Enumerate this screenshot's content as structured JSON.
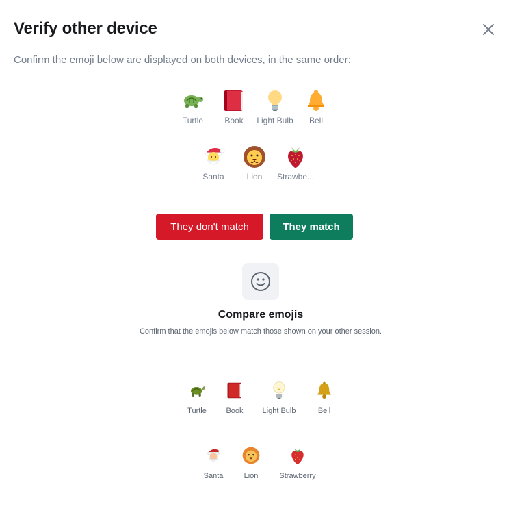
{
  "dialog": {
    "title": "Verify other device",
    "description": "Confirm the emoji below are displayed on both devices, in the same order:"
  },
  "emojis_top": [
    {
      "label": "Turtle",
      "icon": "turtle-icon"
    },
    {
      "label": "Book",
      "icon": "book-icon"
    },
    {
      "label": "Light Bulb",
      "icon": "light-bulb-icon"
    },
    {
      "label": "Bell",
      "icon": "bell-icon"
    },
    {
      "label": "Santa",
      "icon": "santa-icon"
    },
    {
      "label": "Lion",
      "icon": "lion-icon"
    },
    {
      "label": "Strawbe...",
      "icon": "strawberry-icon"
    }
  ],
  "buttons": {
    "dont_match": "They don't match",
    "match": "They match"
  },
  "compare": {
    "title": "Compare emojis",
    "subtitle": "Confirm that the emojis below match those shown on your other session.",
    "emojis": [
      {
        "label": "Turtle",
        "icon": "turtle-icon"
      },
      {
        "label": "Book",
        "icon": "book-icon"
      },
      {
        "label": "Light Bulb",
        "icon": "light-bulb-icon"
      },
      {
        "label": "Bell",
        "icon": "bell-icon"
      },
      {
        "label": "Santa",
        "icon": "santa-icon"
      },
      {
        "label": "Lion",
        "icon": "lion-icon"
      },
      {
        "label": "Strawberry",
        "icon": "strawberry-icon"
      }
    ]
  },
  "colors": {
    "danger": "#d51928",
    "primary": "#0d7d5e",
    "text": "#17191c",
    "muted": "#737d8c"
  }
}
